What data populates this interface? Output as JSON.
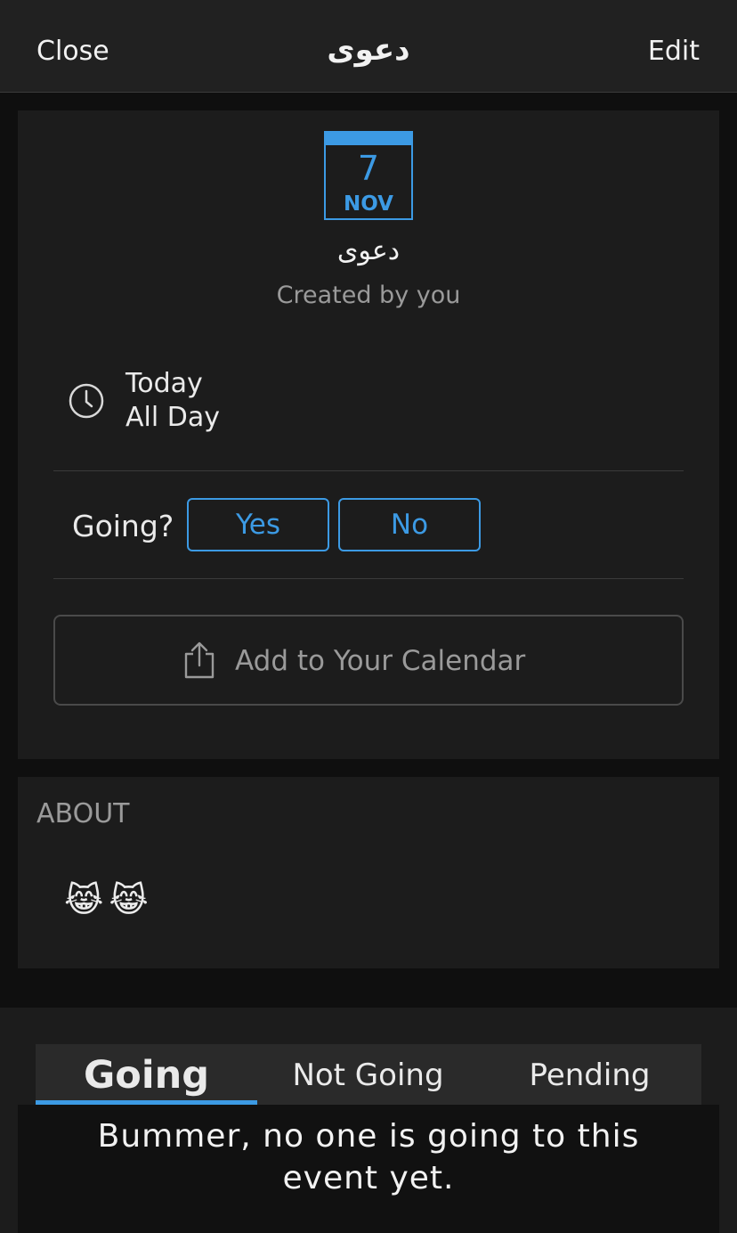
{
  "navbar": {
    "close_label": "Close",
    "title": "دعوى",
    "edit_label": "Edit"
  },
  "event": {
    "calendar_day": "7",
    "calendar_month": "NOV",
    "title": "دعوى",
    "created_by": "Created by you",
    "time_line1": "Today",
    "time_line2": "All Day",
    "going_prompt": "Going?",
    "yes_label": "Yes",
    "no_label": "No",
    "add_calendar_label": "Add to Your Calendar"
  },
  "about": {
    "title": "ABOUT",
    "text": "😹😹"
  },
  "tabs": [
    {
      "label": "Going",
      "selected": true
    },
    {
      "label": "Not Going",
      "selected": false
    },
    {
      "label": "Pending",
      "selected": false
    }
  ],
  "empty_message": "Bummer, no one is going to this event yet.",
  "colors": {
    "accent": "#3c9ae4",
    "background": "#0f0f0f",
    "card": "#1c1c1c",
    "navbar": "#212121",
    "muted_text": "#9a9a9a"
  },
  "icons": {
    "clock": "clock-icon",
    "share": "share-icon"
  }
}
